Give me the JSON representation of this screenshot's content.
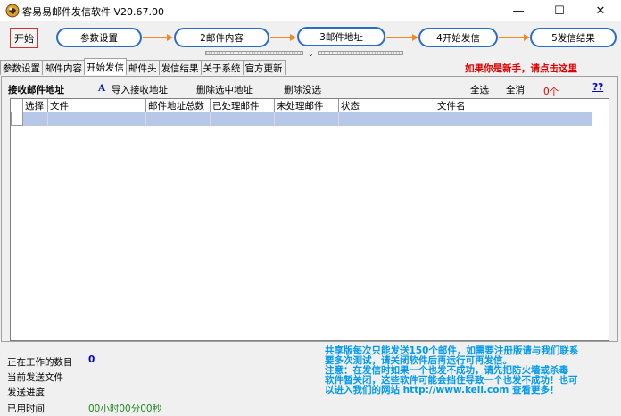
{
  "window": {
    "title": "客易易邮件发信软件 V20.67.00",
    "minimize_glyph": "—",
    "maximize_glyph": "☐",
    "close_glyph": "✕"
  },
  "workflow": {
    "start_label": "开始",
    "steps": [
      "参数设置",
      "2邮件内容",
      "3邮件地址",
      "4开始发信",
      "5发信结果"
    ],
    "splitter_glyph": "⌄"
  },
  "tabs": [
    "参数设置",
    "邮件内容",
    "开始发信",
    "邮件头",
    "发信结果",
    "关于系统",
    "官方更新"
  ],
  "active_tab_index": 2,
  "newbie_link": "如果你是新手，请点击这里",
  "toolbar": {
    "section_title": "接收邮件地址",
    "import_icon_glyph": "A",
    "import_label": "导入接收地址",
    "delete_selected_label": "删除选中地址",
    "delete_unsent_label": "删除没选",
    "select_all_label": "全选",
    "select_none_label": "全消",
    "count": "0个",
    "help_label": "??"
  },
  "table": {
    "columns": [
      "选择",
      "文件",
      "邮件地址总数",
      "已处理邮件",
      "未处理邮件",
      "状态",
      "文件名"
    ]
  },
  "status": {
    "working_label": "正在工作的数目",
    "working_value": "0",
    "current_file_label": "当前发送文件",
    "progress_label": "发送进度",
    "elapsed_label": "已用时间",
    "elapsed_value": "00小时00分00秒"
  },
  "notice": "共享版每次只能发送150个邮件，如需要注册版请与我们联系\n要多次测试，请关闭软件后再运行可再发信。\n        注意：在发信时如果一个也发不成功，请先把防火墙或杀毒\n软件暂关闭，这些软件可能会挡住导致一个也发不成功！也可\n以进入我们的网站 http://www.kell.com 查看更多！",
  "colors": {
    "step_border": "#2a6cc8",
    "arrow": "#f08a28",
    "link_red": "#e00000",
    "row_highlight": "#b7c7e8",
    "notice_blue": "#0099ee"
  }
}
